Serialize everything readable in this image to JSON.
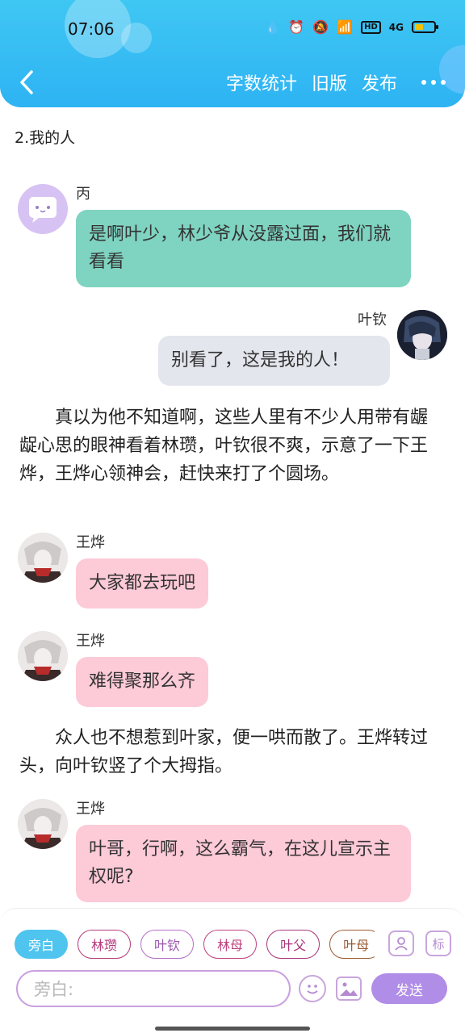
{
  "status_bar": {
    "time": "07:06",
    "network": "4G",
    "hd": "HD"
  },
  "header": {
    "back_icon": "chevron-left-icon",
    "actions": {
      "word_count": "字数统计",
      "old_version": "旧版",
      "publish": "发布"
    },
    "more_icon": "more-horizontal-icon"
  },
  "chapter": {
    "title": "2.我的人"
  },
  "messages": [
    {
      "speaker": "丙",
      "text": "是啊叶少，林少爷从没露过面，我们就看看",
      "side": "left",
      "bubble_color": "#7fd3c1"
    },
    {
      "speaker": "叶钦",
      "text": "别看了，这是我的人！",
      "side": "right",
      "bubble_color": "#e3e6ed"
    }
  ],
  "narration_1": "真以为他不知道啊，这些人里有不少人用带有龌龊心思的眼神看着林瓒，叶钦很不爽，示意了一下王烨，王烨心领神会，赶快来打了个圆场。",
  "messages_2": [
    {
      "speaker": "王烨",
      "text": "大家都去玩吧",
      "side": "left",
      "bubble_color": "#fdcad8"
    },
    {
      "speaker": "王烨",
      "text": "难得聚那么齐",
      "side": "left",
      "bubble_color": "#fdcad8"
    }
  ],
  "narration_2": "众人也不想惹到叶家，便一哄而散了。王烨转过头，向叶钦竖了个大拇指。",
  "messages_3": [
    {
      "speaker": "王烨",
      "text": "叶哥，行啊，这么霸气，在这儿宣示主权呢?",
      "side": "left",
      "bubble_color": "#fdcad8"
    }
  ],
  "composer": {
    "role_chips": [
      "旁白",
      "林瓒",
      "叶钦",
      "林母",
      "叶父",
      "叶母"
    ],
    "active_chip": "旁白",
    "input_placeholder": "旁白:",
    "tag_label": "标",
    "send_label": "发送",
    "icons": [
      "person-icon",
      "tag-icon",
      "emoji-icon",
      "image-icon"
    ]
  },
  "colors": {
    "header": "#2eb3f3",
    "accent": "#4ec4ef",
    "send": "#b08de6"
  }
}
